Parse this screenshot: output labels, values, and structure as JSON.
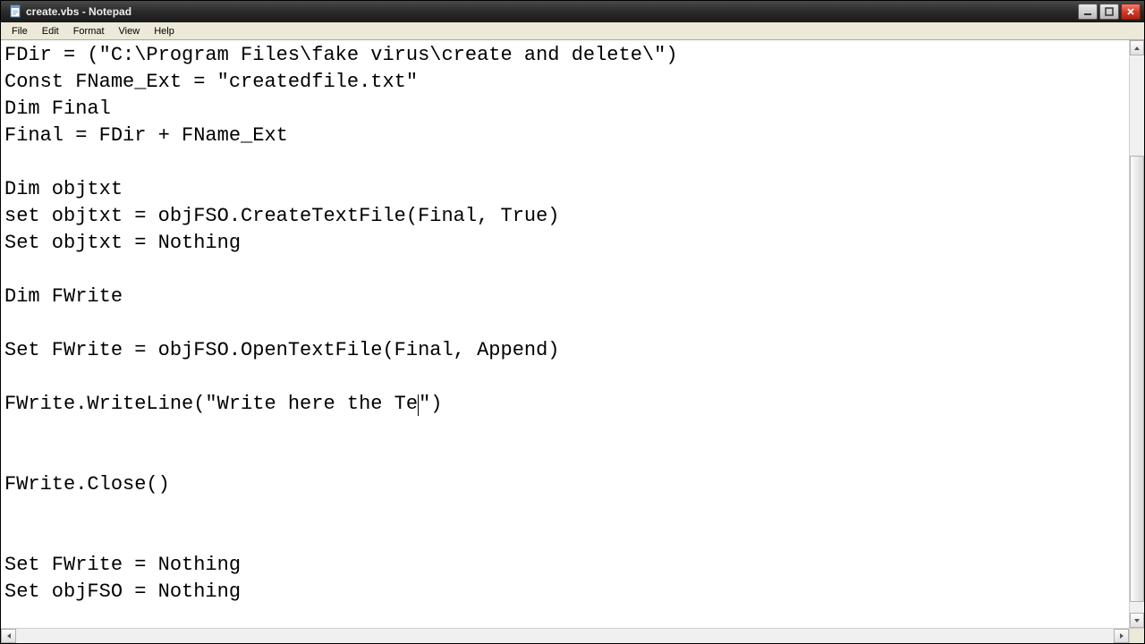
{
  "window": {
    "title": "create.vbs - Notepad"
  },
  "menu": {
    "file": "File",
    "edit": "Edit",
    "format": "Format",
    "view": "View",
    "help": "Help"
  },
  "editor": {
    "line1": "FDir = (\"C:\\Program Files\\fake virus\\create and delete\\\")",
    "line2": "Const FName_Ext = \"createdfile.txt\"",
    "line3": "Dim Final",
    "line4": "Final = FDir + FName_Ext",
    "line5": "",
    "line6": "Dim objtxt",
    "line7": "set objtxt = objFSO.CreateTextFile(Final, True)",
    "line8": "Set objtxt = Nothing",
    "line9": "",
    "line10": "Dim FWrite",
    "line11": "",
    "line12": "Set FWrite = objFSO.OpenTextFile(Final, Append)",
    "line13": "",
    "line14a": "FWrite.WriteLine(\"Write here the Te",
    "line14b": "\")",
    "line15": "",
    "line16": "",
    "line17": "FWrite.Close()",
    "line18": "",
    "line19": "",
    "line20": "Set FWrite = Nothing",
    "line21": "Set objFSO = Nothing"
  }
}
